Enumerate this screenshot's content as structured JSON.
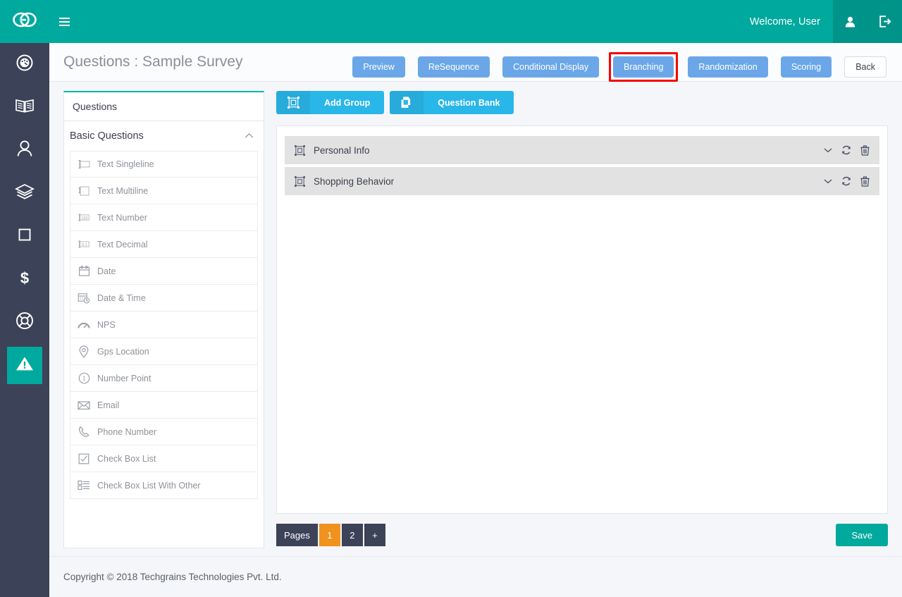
{
  "app": {
    "logo_icon": "go-logo-icon",
    "menu_icon": "hamburger-menu-icon",
    "welcome_text": "Welcome, User",
    "profile_icon": "user-profile-icon",
    "logout_icon": "logout-icon",
    "brand_teal": "#00a99d",
    "brand_teal_dark": "#009389",
    "rail_bg": "#3c4258"
  },
  "rail": {
    "items": [
      {
        "icon": "dashboard-gauge-icon",
        "active": false
      },
      {
        "icon": "book-icon",
        "active": false
      },
      {
        "icon": "user-icon",
        "active": false
      },
      {
        "icon": "layers-icon",
        "active": false
      },
      {
        "icon": "square-icon",
        "active": false
      },
      {
        "icon": "dollar-icon",
        "active": false
      },
      {
        "icon": "lifebuoy-icon",
        "active": false
      },
      {
        "icon": "warning-triangle-icon",
        "active": true
      }
    ]
  },
  "page": {
    "title": "Questions : Sample Survey",
    "buttons": [
      {
        "label": "Preview",
        "style": "primary",
        "highlighted": false
      },
      {
        "label": "ReSequence",
        "style": "primary",
        "highlighted": false
      },
      {
        "label": "Conditional Display",
        "style": "primary",
        "highlighted": false
      },
      {
        "label": "Branching",
        "style": "primary",
        "highlighted": true
      },
      {
        "label": "Randomization",
        "style": "primary",
        "highlighted": false
      },
      {
        "label": "Scoring",
        "style": "primary",
        "highlighted": false
      },
      {
        "label": "Back",
        "style": "ghost",
        "highlighted": false
      }
    ],
    "highlight_color": "#f40000",
    "button_color": "#6ba7e8"
  },
  "questions_panel": {
    "tab_label": "Questions",
    "accordion_label": "Basic Questions",
    "accordion_icon": "chevron-up-icon",
    "items": [
      {
        "label": "Text Singleline",
        "icon": "text-singleline-icon"
      },
      {
        "label": "Text Multiline",
        "icon": "text-multiline-icon"
      },
      {
        "label": "Text Number",
        "icon": "text-number-icon"
      },
      {
        "label": "Text Decimal",
        "icon": "text-decimal-icon"
      },
      {
        "label": "Date",
        "icon": "calendar-icon"
      },
      {
        "label": "Date & Time",
        "icon": "calendar-clock-icon"
      },
      {
        "label": "NPS",
        "icon": "gauge-icon"
      },
      {
        "label": "Gps Location",
        "icon": "map-pin-icon"
      },
      {
        "label": "Number Point",
        "icon": "number-circle-icon"
      },
      {
        "label": "Email",
        "icon": "envelope-icon"
      },
      {
        "label": "Phone Number",
        "icon": "phone-icon"
      },
      {
        "label": "Check Box List",
        "icon": "checkbox-icon"
      },
      {
        "label": "Check Box List With Other",
        "icon": "checkbox-list-icon"
      }
    ]
  },
  "toolbar": {
    "add_group_label": "Add Group",
    "add_group_icon": "group-frame-icon",
    "question_bank_label": "Question Bank",
    "question_bank_icon": "copy-pages-icon",
    "button_color": "#29b6e8"
  },
  "groups": [
    {
      "name": "Personal Info",
      "icon": "group-frame-icon",
      "actions": [
        {
          "icon": "chevron-down-icon"
        },
        {
          "icon": "refresh-icon"
        },
        {
          "icon": "trash-icon"
        }
      ]
    },
    {
      "name": "Shopping Behavior",
      "icon": "group-frame-icon",
      "actions": [
        {
          "icon": "chevron-down-icon"
        },
        {
          "icon": "refresh-icon"
        },
        {
          "icon": "trash-icon"
        }
      ]
    }
  ],
  "pager": {
    "label": "Pages",
    "pages": [
      {
        "label": "1",
        "active": true
      },
      {
        "label": "2",
        "active": false
      }
    ],
    "add_label": "+",
    "active_color": "#f0921e"
  },
  "save": {
    "label": "Save",
    "color": "#00a99d"
  },
  "footer": {
    "text": "Copyright © 2018 Techgrains Technologies Pvt. Ltd."
  }
}
